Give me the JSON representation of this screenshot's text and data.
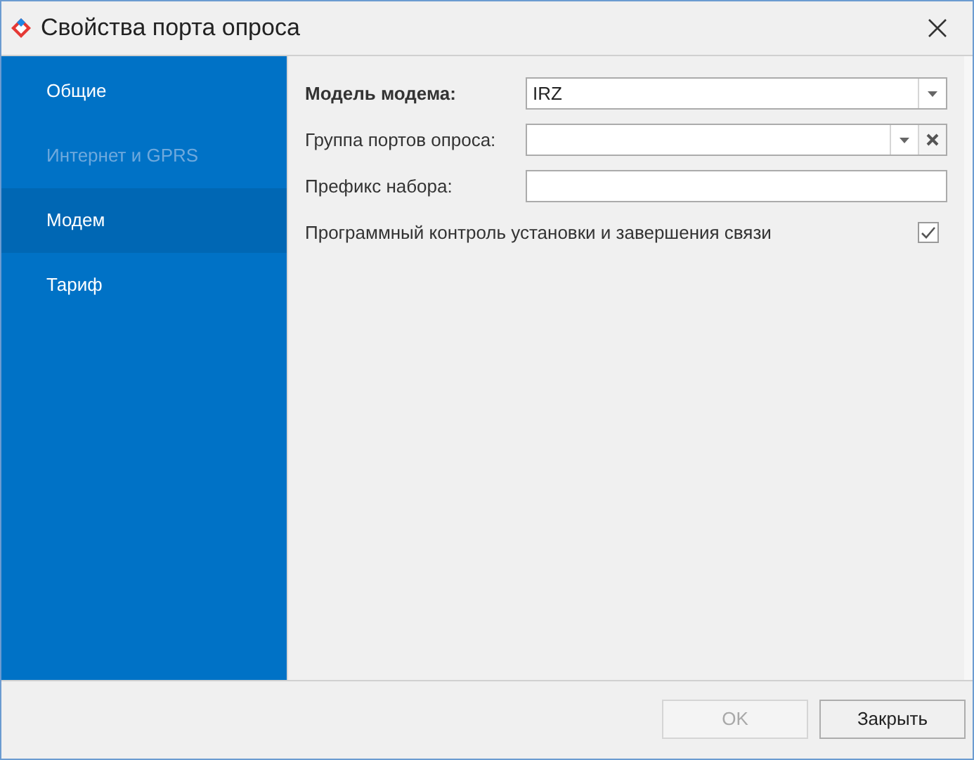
{
  "window": {
    "title": "Свойства порта опроса"
  },
  "sidebar": {
    "items": [
      {
        "label": "Общие",
        "selected": false,
        "disabled": false
      },
      {
        "label": "Интернет и GPRS",
        "selected": false,
        "disabled": true
      },
      {
        "label": "Модем",
        "selected": true,
        "disabled": false
      },
      {
        "label": "Тариф",
        "selected": false,
        "disabled": false
      }
    ]
  },
  "fields": [
    {
      "kind": "dropdown",
      "label": "Модель модема:",
      "bold": true,
      "value": "IRZ"
    },
    {
      "kind": "dropdown_clear",
      "label": "Группа портов опроса:",
      "bold": false
    },
    {
      "kind": "text",
      "label": "Префикс набора:",
      "bold": false
    },
    {
      "kind": "checkbox",
      "label": "Программный контроль установки и завершения связи",
      "bold": false,
      "checked": true
    }
  ],
  "buttons": [
    {
      "label": "OK",
      "disabled": true
    },
    {
      "label": "Закрыть",
      "disabled": false
    }
  ]
}
